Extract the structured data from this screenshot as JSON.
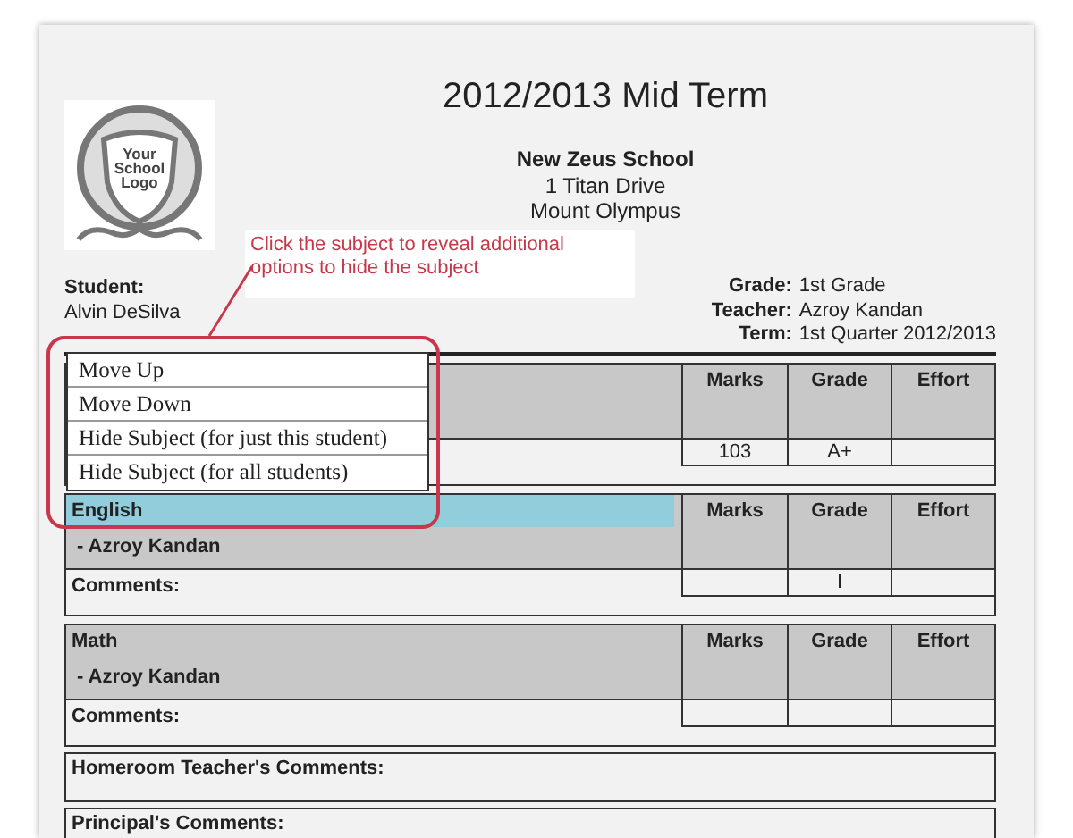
{
  "title": "2012/2013 Mid Term",
  "logo": {
    "lines": [
      "Your",
      "School",
      "Logo"
    ]
  },
  "school": {
    "name": "New Zeus School",
    "address": [
      "1 Titan Drive",
      "Mount Olympus"
    ]
  },
  "student": {
    "label": "Student:",
    "value": "Alvin DeSilva"
  },
  "info": [
    {
      "label": "Grade:",
      "value": "1st Grade"
    },
    {
      "label": "Teacher:",
      "value": "Azroy Kandan"
    },
    {
      "label": "Term:",
      "value": "1st Quarter 2012/2013"
    }
  ],
  "subjects": [
    {
      "selected": false,
      "columns": [
        "Marks",
        "Grade",
        "Effort"
      ],
      "marks": "103",
      "grade": "A+"
    },
    {
      "name": "English",
      "teacher": "- Azroy Kandan",
      "selected": true,
      "columns": [
        "Marks",
        "Grade",
        "Effort"
      ],
      "comments_label": "Comments:",
      "grade": "I"
    },
    {
      "name": "Math",
      "teacher": "- Azroy Kandan",
      "selected": false,
      "columns": [
        "Marks",
        "Grade",
        "Effort"
      ],
      "comments_label": "Comments:"
    }
  ],
  "comment_boxes": [
    {
      "label": "Homeroom Teacher's Comments:"
    },
    {
      "label": "Principal's Comments:"
    }
  ],
  "context_menu": [
    {
      "label": "Move Up"
    },
    {
      "label": "Move Down"
    },
    {
      "label": "Hide Subject (for just this student)"
    },
    {
      "label": "Hide Subject (for all students)"
    }
  ],
  "annotation": {
    "text": "Click the subject to reveal additional options to hide the subject"
  }
}
